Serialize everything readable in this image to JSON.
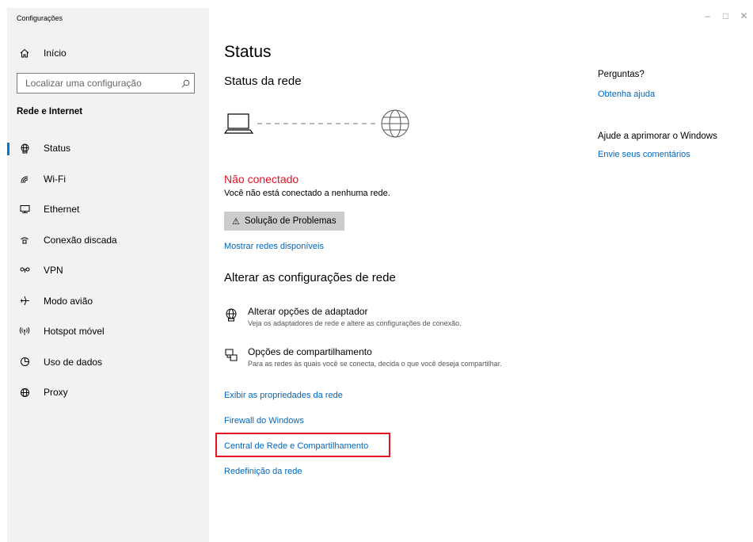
{
  "window": {
    "title": "Configurações",
    "controls": {
      "minimize": "–",
      "maximize": "□",
      "close": "✕"
    }
  },
  "sidebar": {
    "home_label": "Início",
    "search_placeholder": "Localizar uma configuração",
    "section_title": "Rede e Internet",
    "items": [
      {
        "label": "Status",
        "icon": "status-globe-icon",
        "active": true
      },
      {
        "label": "Wi-Fi",
        "icon": "wifi-icon"
      },
      {
        "label": "Ethernet",
        "icon": "ethernet-icon"
      },
      {
        "label": "Conexão discada",
        "icon": "dialup-icon"
      },
      {
        "label": "VPN",
        "icon": "vpn-icon"
      },
      {
        "label": "Modo avião",
        "icon": "airplane-icon"
      },
      {
        "label": "Hotspot móvel",
        "icon": "hotspot-icon"
      },
      {
        "label": "Uso de dados",
        "icon": "data-usage-icon"
      },
      {
        "label": "Proxy",
        "icon": "proxy-globe-icon"
      }
    ]
  },
  "main": {
    "title": "Status",
    "network_status_heading": "Status da rede",
    "status": "Não conectado",
    "status_description": "Você não está conectado a nenhuma rede.",
    "troubleshoot_button": "Solução de Problemas",
    "show_networks_link": "Mostrar redes disponíveis",
    "change_settings_heading": "Alterar as configurações de rede",
    "options": [
      {
        "title": "Alterar opções de adaptador",
        "description": "Veja os adaptadores de rede e altere as configurações de conexão."
      },
      {
        "title": "Opções de compartilhamento",
        "description": "Para as redes às quais você se conecta, decida o que você deseja compartilhar."
      }
    ],
    "links": {
      "properties": "Exibir as propriedades da rede",
      "firewall": "Firewall do Windows",
      "network_center": "Central de Rede e Compartilhamento",
      "reset": "Redefinição da rede"
    }
  },
  "aside": {
    "questions_heading": "Perguntas?",
    "help_link": "Obtenha ajuda",
    "improve_heading": "Ajude a aprimorar o Windows",
    "feedback_link": "Envie seus comentários"
  },
  "colors": {
    "accent": "#0067c0",
    "error": "#e81123",
    "sidebar_bg": "#f2f2f2",
    "button_bg": "#cccccc"
  }
}
